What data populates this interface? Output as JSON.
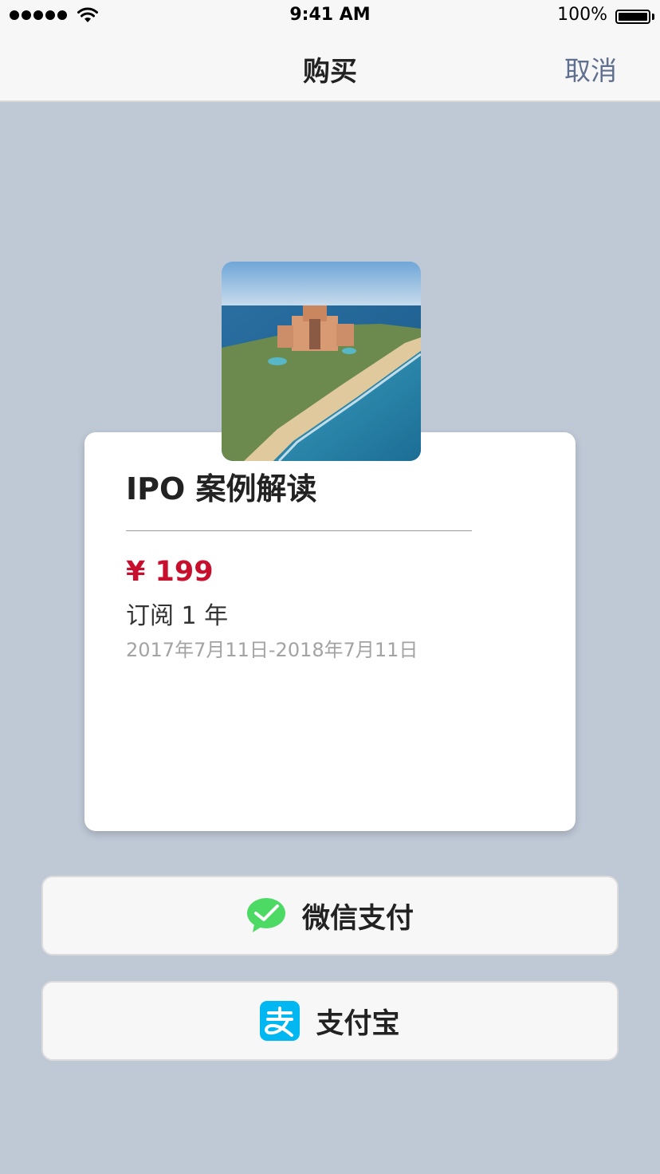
{
  "status_bar": {
    "time": "9:41 AM",
    "battery_text": "100%",
    "battery_level": 1.0
  },
  "nav": {
    "title": "购买",
    "cancel_label": "取消"
  },
  "product": {
    "name": "IPO 案例解读",
    "price": "¥ 199",
    "plan": "订阅 1 年",
    "period": "2017年7月11日-2018年7月11日"
  },
  "payment": {
    "wechat_label": "微信支付",
    "alipay_label": "支付宝"
  },
  "icons": {
    "signal": "cellular-signal-icon",
    "wifi": "wifi-icon",
    "battery": "battery-icon",
    "wechat": "wechat-pay-icon",
    "alipay": "alipay-icon"
  },
  "colors": {
    "background": "#bfc9d6",
    "price": "#c8102e",
    "cancel": "#5f6f8e",
    "wechat": "#4cd964",
    "alipay": "#00b7f1"
  }
}
